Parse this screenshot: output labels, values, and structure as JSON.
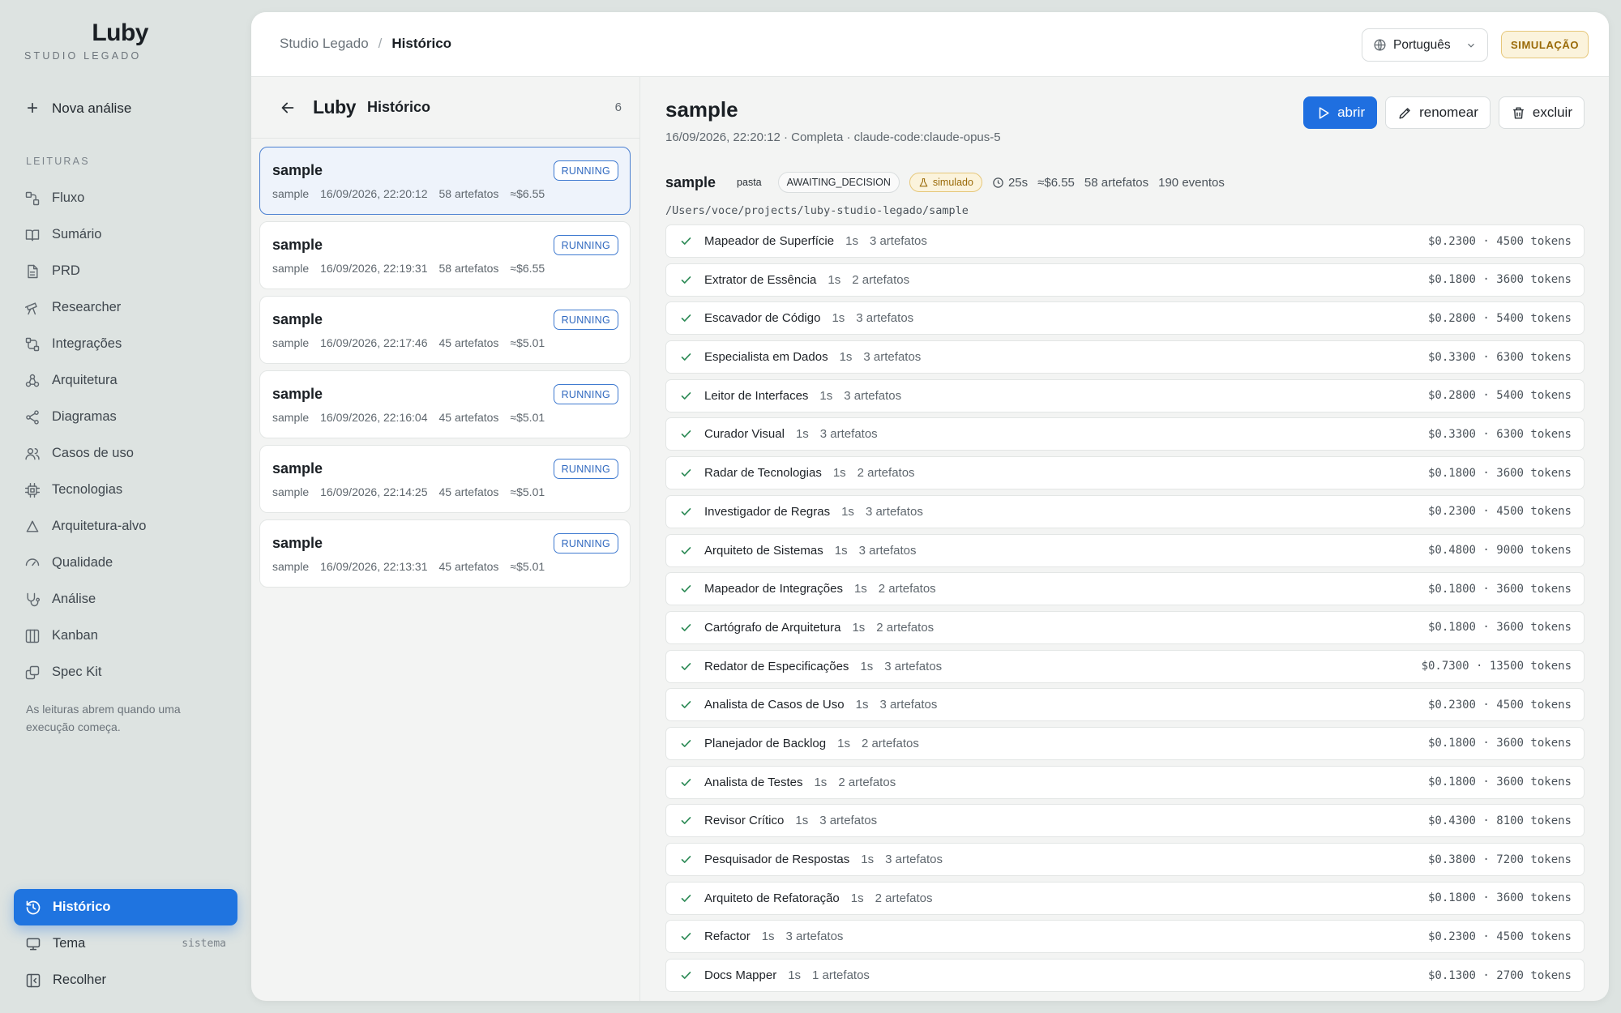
{
  "brand": {
    "logo": "Luby",
    "subtitle": "STUDIO LEGADO"
  },
  "sidebar": {
    "new_analysis": "Nova análise",
    "section_title": "LEITURAS",
    "items": [
      {
        "label": "Fluxo",
        "icon": "flow-icon"
      },
      {
        "label": "Sumário",
        "icon": "book-icon"
      },
      {
        "label": "PRD",
        "icon": "document-icon"
      },
      {
        "label": "Researcher",
        "icon": "telescope-icon"
      },
      {
        "label": "Integrações",
        "icon": "integrations-icon"
      },
      {
        "label": "Arquitetura",
        "icon": "architecture-icon"
      },
      {
        "label": "Diagramas",
        "icon": "share-nodes-icon"
      },
      {
        "label": "Casos de uso",
        "icon": "users-icon"
      },
      {
        "label": "Tecnologias",
        "icon": "chip-icon"
      },
      {
        "label": "Arquitetura-alvo",
        "icon": "recycle-icon"
      },
      {
        "label": "Qualidade",
        "icon": "gauge-icon"
      },
      {
        "label": "Análise",
        "icon": "stethoscope-icon"
      },
      {
        "label": "Kanban",
        "icon": "kanban-icon"
      },
      {
        "label": "Spec Kit",
        "icon": "copy-icon"
      }
    ],
    "note": "As leituras abrem quando uma execução começa.",
    "bottom": {
      "history": "Histórico",
      "theme": "Tema",
      "theme_value": "sistema",
      "collapse": "Recolher"
    }
  },
  "topbar": {
    "breadcrumb_root": "Studio Legado",
    "breadcrumb_sep": "/",
    "breadcrumb_current": "Histórico",
    "language": "Português",
    "mode_badge": "SIMULAÇÃO"
  },
  "history": {
    "logo": "Luby",
    "title": "Histórico",
    "count": "6",
    "runs": [
      {
        "name": "sample",
        "folder": "sample",
        "date": "16/09/2026, 22:20:12",
        "artifacts": "58 artefatos",
        "cost": "≈$6.55",
        "status": "RUNNING"
      },
      {
        "name": "sample",
        "folder": "sample",
        "date": "16/09/2026, 22:19:31",
        "artifacts": "58 artefatos",
        "cost": "≈$6.55",
        "status": "RUNNING"
      },
      {
        "name": "sample",
        "folder": "sample",
        "date": "16/09/2026, 22:17:46",
        "artifacts": "45 artefatos",
        "cost": "≈$5.01",
        "status": "RUNNING"
      },
      {
        "name": "sample",
        "folder": "sample",
        "date": "16/09/2026, 22:16:04",
        "artifacts": "45 artefatos",
        "cost": "≈$5.01",
        "status": "RUNNING"
      },
      {
        "name": "sample",
        "folder": "sample",
        "date": "16/09/2026, 22:14:25",
        "artifacts": "45 artefatos",
        "cost": "≈$5.01",
        "status": "RUNNING"
      },
      {
        "name": "sample",
        "folder": "sample",
        "date": "16/09/2026, 22:13:31",
        "artifacts": "45 artefatos",
        "cost": "≈$5.01",
        "status": "RUNNING"
      }
    ]
  },
  "detail": {
    "title": "sample",
    "subtitle": "16/09/2026, 22:20:12 · Completa · claude-code:claude-opus-5",
    "actions": {
      "open": "abrir",
      "rename": "renomear",
      "delete": "excluir"
    },
    "info": {
      "name": "sample",
      "kind": "pasta",
      "state": "AWAITING_DECISION",
      "sim": "simulado",
      "duration": "25s",
      "cost": "≈$6.55",
      "artifacts": "58 artefatos",
      "events": "190 eventos"
    },
    "path": "/Users/voce/projects/luby-studio-legado/sample",
    "agents": [
      {
        "name": "Mapeador de Superfície",
        "duration": "1s",
        "artifacts": "3 artefatos",
        "cost": "$0.2300 · 4500 tokens"
      },
      {
        "name": "Extrator de Essência",
        "duration": "1s",
        "artifacts": "2 artefatos",
        "cost": "$0.1800 · 3600 tokens"
      },
      {
        "name": "Escavador de Código",
        "duration": "1s",
        "artifacts": "3 artefatos",
        "cost": "$0.2800 · 5400 tokens"
      },
      {
        "name": "Especialista em Dados",
        "duration": "1s",
        "artifacts": "3 artefatos",
        "cost": "$0.3300 · 6300 tokens"
      },
      {
        "name": "Leitor de Interfaces",
        "duration": "1s",
        "artifacts": "3 artefatos",
        "cost": "$0.2800 · 5400 tokens"
      },
      {
        "name": "Curador Visual",
        "duration": "1s",
        "artifacts": "3 artefatos",
        "cost": "$0.3300 · 6300 tokens"
      },
      {
        "name": "Radar de Tecnologias",
        "duration": "1s",
        "artifacts": "2 artefatos",
        "cost": "$0.1800 · 3600 tokens"
      },
      {
        "name": "Investigador de Regras",
        "duration": "1s",
        "artifacts": "3 artefatos",
        "cost": "$0.2300 · 4500 tokens"
      },
      {
        "name": "Arquiteto de Sistemas",
        "duration": "1s",
        "artifacts": "3 artefatos",
        "cost": "$0.4800 · 9000 tokens"
      },
      {
        "name": "Mapeador de Integrações",
        "duration": "1s",
        "artifacts": "2 artefatos",
        "cost": "$0.1800 · 3600 tokens"
      },
      {
        "name": "Cartógrafo de Arquitetura",
        "duration": "1s",
        "artifacts": "2 artefatos",
        "cost": "$0.1800 · 3600 tokens"
      },
      {
        "name": "Redator de Especificações",
        "duration": "1s",
        "artifacts": "3 artefatos",
        "cost": "$0.7300 · 13500 tokens"
      },
      {
        "name": "Analista de Casos de Uso",
        "duration": "1s",
        "artifacts": "3 artefatos",
        "cost": "$0.2300 · 4500 tokens"
      },
      {
        "name": "Planejador de Backlog",
        "duration": "1s",
        "artifacts": "2 artefatos",
        "cost": "$0.1800 · 3600 tokens"
      },
      {
        "name": "Analista de Testes",
        "duration": "1s",
        "artifacts": "2 artefatos",
        "cost": "$0.1800 · 3600 tokens"
      },
      {
        "name": "Revisor Crítico",
        "duration": "1s",
        "artifacts": "3 artefatos",
        "cost": "$0.4300 · 8100 tokens"
      },
      {
        "name": "Pesquisador de Respostas",
        "duration": "1s",
        "artifacts": "3 artefatos",
        "cost": "$0.3800 · 7200 tokens"
      },
      {
        "name": "Arquiteto de Refatoração",
        "duration": "1s",
        "artifacts": "2 artefatos",
        "cost": "$0.1800 · 3600 tokens"
      },
      {
        "name": "Refactor",
        "duration": "1s",
        "artifacts": "3 artefatos",
        "cost": "$0.2300 · 4500 tokens"
      },
      {
        "name": "Docs Mapper",
        "duration": "1s",
        "artifacts": "1 artefatos",
        "cost": "$0.1300 · 2700 tokens"
      }
    ]
  },
  "colors": {
    "accent": "#1f6fe0",
    "success": "#2e8b57",
    "warning": "#9a6a08",
    "running": "#2f68bf"
  }
}
